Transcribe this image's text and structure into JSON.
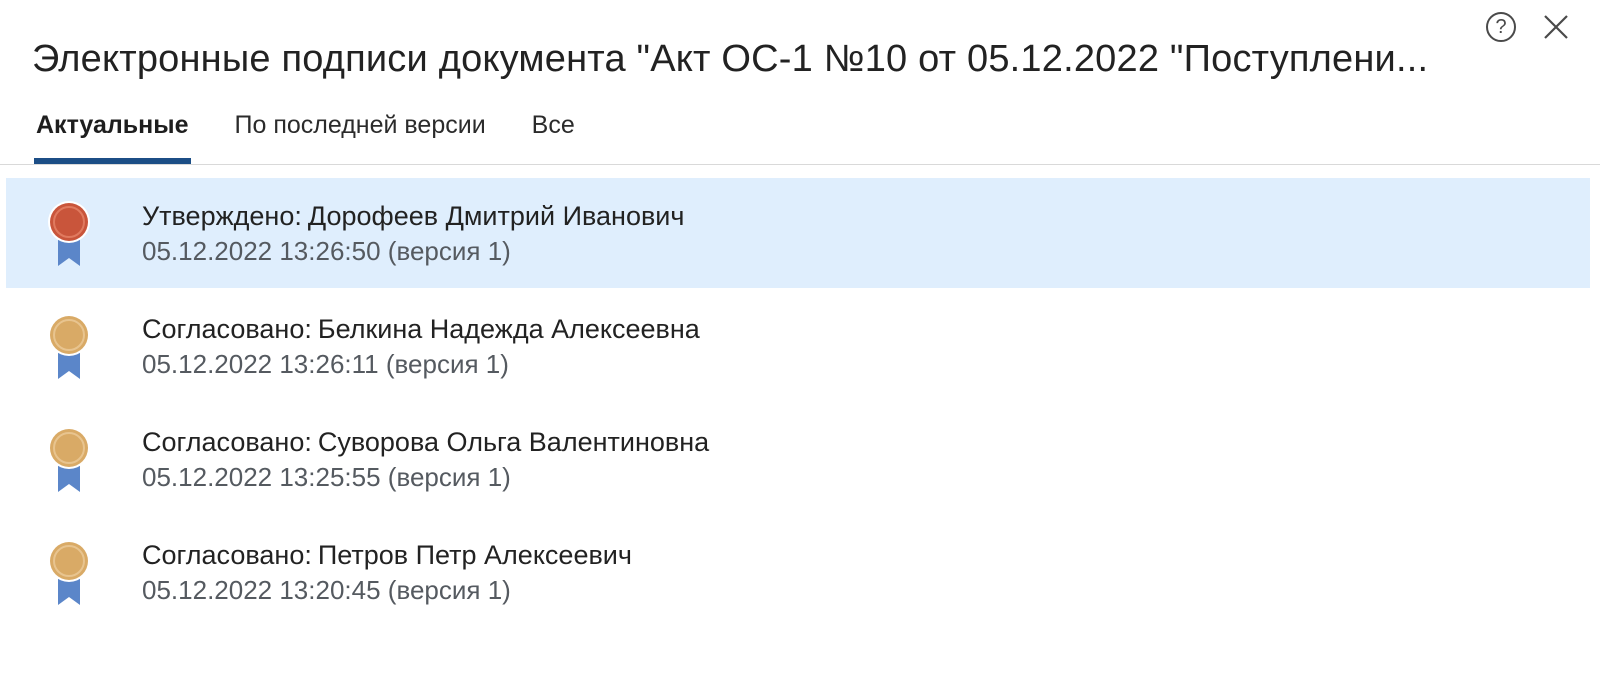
{
  "dialog": {
    "title": "Электронные подписи документа \"Акт ОС-1 №10 от 05.12.2022 \"Поступлени...",
    "help_icon": "question-circle-icon",
    "close_icon": "close-icon",
    "help_glyph": "?"
  },
  "tabs": [
    {
      "label": "Актуальные",
      "active": true
    },
    {
      "label": "По последней версии",
      "active": false
    },
    {
      "label": "Все",
      "active": false
    }
  ],
  "signatures": [
    {
      "status": "Утверждено:",
      "signer": "Дорофеев Дмитрий Иванович",
      "datetime": "05.12.2022 13:26:50",
      "version": "(версия 1)",
      "icon": "approved-medal-icon",
      "medal_color": "#c9553b",
      "selected": true
    },
    {
      "status": "Согласовано:",
      "signer": "Белкина Надежда Алексеевна",
      "datetime": "05.12.2022 13:26:11",
      "version": "(версия 1)",
      "icon": "agreed-medal-icon",
      "medal_color": "#d9aa66",
      "selected": false
    },
    {
      "status": "Согласовано:",
      "signer": "Суворова Ольга Валентиновна",
      "datetime": "05.12.2022 13:25:55",
      "version": "(версия 1)",
      "icon": "agreed-medal-icon",
      "medal_color": "#d9aa66",
      "selected": false
    },
    {
      "status": "Согласовано:",
      "signer": "Петров Петр Алексеевич",
      "datetime": "05.12.2022 13:20:45",
      "version": "(версия 1)",
      "icon": "agreed-medal-icon",
      "medal_color": "#d9aa66",
      "selected": false
    }
  ],
  "colors": {
    "tab_underline": "#1c4e86",
    "selected_row": "#dfeefd",
    "ribbon": "#5b86c9"
  }
}
